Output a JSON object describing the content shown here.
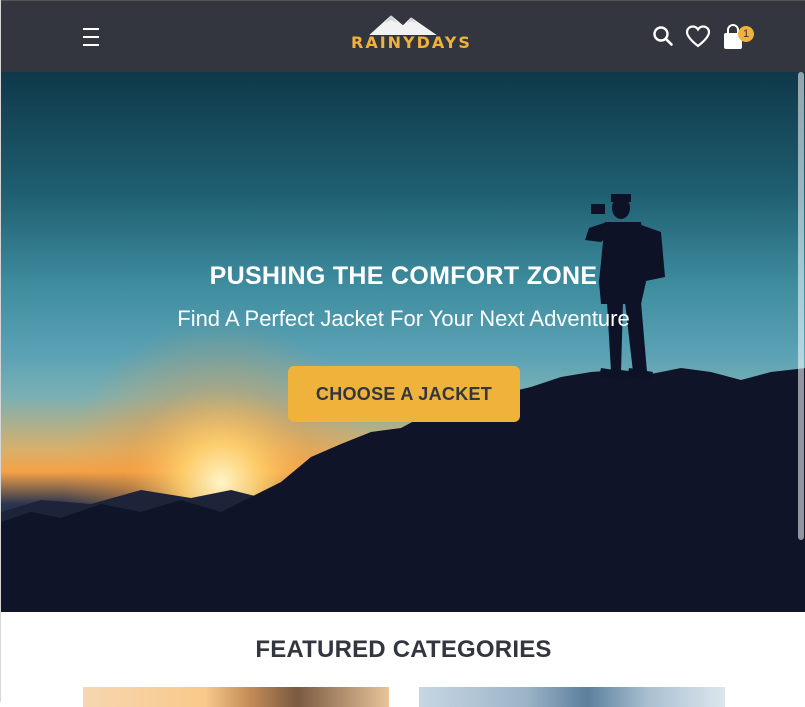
{
  "header": {
    "logo_text": "RAINYDAYS",
    "icons": [
      "menu-icon",
      "search-icon",
      "heart-icon",
      "shopping-bag-icon"
    ],
    "cart_count": "1",
    "brand_color": "#33363f",
    "accent_color": "#efb23b"
  },
  "hero": {
    "title": "PUSHING THE COMFORT ZONE",
    "subtitle": "Find A Perfect Jacket For Your Next Adventure",
    "cta_label": "CHOOSE A JACKET"
  },
  "featured": {
    "title": "FEATURED CATEGORIES"
  }
}
